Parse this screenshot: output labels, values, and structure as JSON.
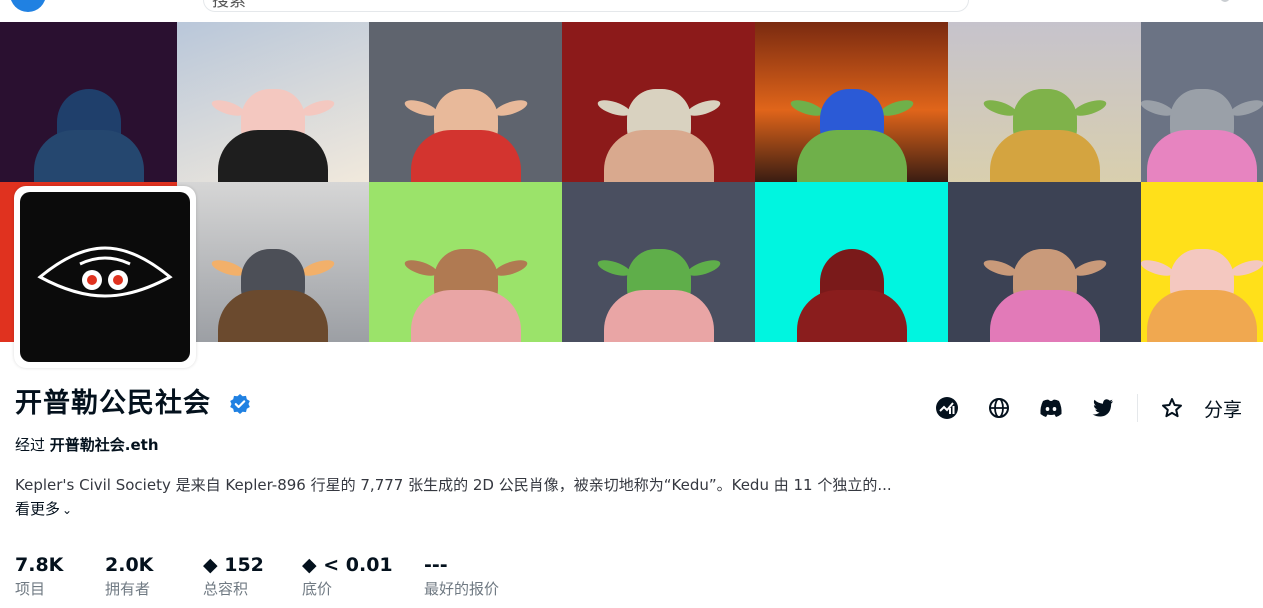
{
  "header": {
    "search_placeholder": "搜索"
  },
  "collection": {
    "name": "开普勒公民社会",
    "by_prefix": "经过",
    "creator": "开普勒社会.eth",
    "description": "Kepler's Civil Society 是来自 Kepler-896 行星的 7,777 张生成的 2D 公民肖像，被亲切地称为“Kedu”。Kedu 由 11 个独立的...",
    "see_more": "看更多"
  },
  "actions": {
    "share_label": "分享",
    "icons": [
      "activity-icon",
      "globe-icon",
      "discord-icon",
      "twitter-icon",
      "star-icon"
    ]
  },
  "stats": [
    {
      "value": "7.8K",
      "label": "项目"
    },
    {
      "value": "2.0K",
      "label": "拥有者"
    },
    {
      "value": "◆ 152",
      "label": "总容积"
    },
    {
      "value": "◆ < 0.01",
      "label": "底价"
    },
    {
      "value": "---",
      "label": "最好的报价"
    }
  ],
  "colors": {
    "accent": "#2081e2",
    "text": "#04111d",
    "muted": "#707a83",
    "banner_tiles": [
      "#2a1030",
      "#e9e2d4",
      "#6b6f78",
      "#8c1a1a",
      "#b8421a",
      "#c9c7cf",
      "#6b7384",
      "#e0321f",
      "#a0a3a8",
      "#9be36a",
      "#4a4f60",
      "#00f5e0",
      "#3c4254",
      "#ffe01a"
    ]
  }
}
